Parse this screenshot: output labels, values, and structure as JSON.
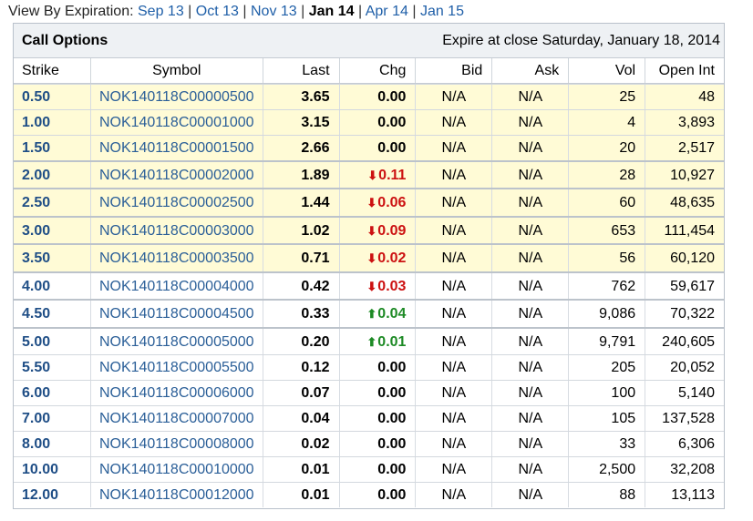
{
  "nav": {
    "label": "View By Expiration:",
    "items": [
      {
        "label": "Sep 13",
        "current": false
      },
      {
        "label": "Oct 13",
        "current": false
      },
      {
        "label": "Nov 13",
        "current": false
      },
      {
        "label": "Jan 14",
        "current": true
      },
      {
        "label": "Apr 14",
        "current": false
      },
      {
        "label": "Jan 15",
        "current": false
      }
    ],
    "separator": "|"
  },
  "panel": {
    "title": "Call Options",
    "expire": "Expire at close Saturday, January 18, 2014"
  },
  "columns": [
    "Strike",
    "Symbol",
    "Last",
    "Chg",
    "Bid",
    "Ask",
    "Vol",
    "Open Int"
  ],
  "colors": {
    "in_the_money_bg": "#fffbd6",
    "down": "#cc1111",
    "up": "#1d8a25",
    "link": "#1f5fa8"
  },
  "rows": [
    {
      "strike": "0.50",
      "symbol": "NOK140118C00000500",
      "last": "3.65",
      "chg": "0.00",
      "dir": "",
      "bid": "N/A",
      "ask": "N/A",
      "vol": "25",
      "oi": "48",
      "itm": true
    },
    {
      "strike": "1.00",
      "symbol": "NOK140118C00001000",
      "last": "3.15",
      "chg": "0.00",
      "dir": "",
      "bid": "N/A",
      "ask": "N/A",
      "vol": "4",
      "oi": "3,893",
      "itm": true
    },
    {
      "strike": "1.50",
      "symbol": "NOK140118C00001500",
      "last": "2.66",
      "chg": "0.00",
      "dir": "",
      "bid": "N/A",
      "ask": "N/A",
      "vol": "20",
      "oi": "2,517",
      "itm": true
    },
    {
      "strike": "2.00",
      "symbol": "NOK140118C00002000",
      "last": "1.89",
      "chg": "0.11",
      "dir": "down",
      "bid": "N/A",
      "ask": "N/A",
      "vol": "28",
      "oi": "10,927",
      "itm": true
    },
    {
      "strike": "2.50",
      "symbol": "NOK140118C00002500",
      "last": "1.44",
      "chg": "0.06",
      "dir": "down",
      "bid": "N/A",
      "ask": "N/A",
      "vol": "60",
      "oi": "48,635",
      "itm": true
    },
    {
      "strike": "3.00",
      "symbol": "NOK140118C00003000",
      "last": "1.02",
      "chg": "0.09",
      "dir": "down",
      "bid": "N/A",
      "ask": "N/A",
      "vol": "653",
      "oi": "111,454",
      "itm": true
    },
    {
      "strike": "3.50",
      "symbol": "NOK140118C00003500",
      "last": "0.71",
      "chg": "0.02",
      "dir": "down",
      "bid": "N/A",
      "ask": "N/A",
      "vol": "56",
      "oi": "60,120",
      "itm": true
    },
    {
      "strike": "4.00",
      "symbol": "NOK140118C00004000",
      "last": "0.42",
      "chg": "0.03",
      "dir": "down",
      "bid": "N/A",
      "ask": "N/A",
      "vol": "762",
      "oi": "59,617",
      "itm": false
    },
    {
      "strike": "4.50",
      "symbol": "NOK140118C00004500",
      "last": "0.33",
      "chg": "0.04",
      "dir": "up",
      "bid": "N/A",
      "ask": "N/A",
      "vol": "9,086",
      "oi": "70,322",
      "itm": false
    },
    {
      "strike": "5.00",
      "symbol": "NOK140118C00005000",
      "last": "0.20",
      "chg": "0.01",
      "dir": "up",
      "bid": "N/A",
      "ask": "N/A",
      "vol": "9,791",
      "oi": "240,605",
      "itm": false
    },
    {
      "strike": "5.50",
      "symbol": "NOK140118C00005500",
      "last": "0.12",
      "chg": "0.00",
      "dir": "",
      "bid": "N/A",
      "ask": "N/A",
      "vol": "205",
      "oi": "20,052",
      "itm": false
    },
    {
      "strike": "6.00",
      "symbol": "NOK140118C00006000",
      "last": "0.07",
      "chg": "0.00",
      "dir": "",
      "bid": "N/A",
      "ask": "N/A",
      "vol": "100",
      "oi": "5,140",
      "itm": false
    },
    {
      "strike": "7.00",
      "symbol": "NOK140118C00007000",
      "last": "0.04",
      "chg": "0.00",
      "dir": "",
      "bid": "N/A",
      "ask": "N/A",
      "vol": "105",
      "oi": "137,528",
      "itm": false
    },
    {
      "strike": "8.00",
      "symbol": "NOK140118C00008000",
      "last": "0.02",
      "chg": "0.00",
      "dir": "",
      "bid": "N/A",
      "ask": "N/A",
      "vol": "33",
      "oi": "6,306",
      "itm": false
    },
    {
      "strike": "10.00",
      "symbol": "NOK140118C00010000",
      "last": "0.01",
      "chg": "0.00",
      "dir": "",
      "bid": "N/A",
      "ask": "N/A",
      "vol": "2,500",
      "oi": "32,208",
      "itm": false
    },
    {
      "strike": "12.00",
      "symbol": "NOK140118C00012000",
      "last": "0.01",
      "chg": "0.00",
      "dir": "",
      "bid": "N/A",
      "ask": "N/A",
      "vol": "88",
      "oi": "13,113",
      "itm": false
    }
  ]
}
